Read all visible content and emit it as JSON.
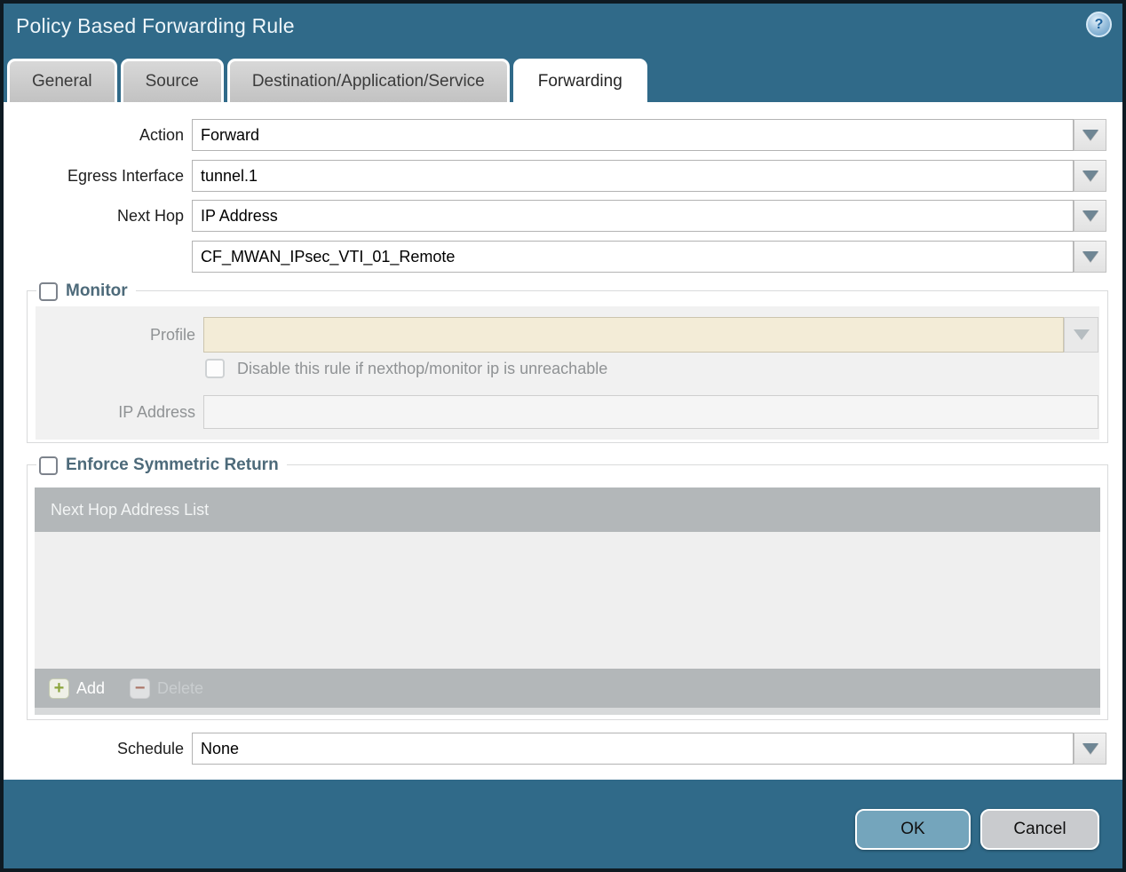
{
  "window": {
    "title": "Policy Based Forwarding Rule"
  },
  "icons": {
    "help_glyph": "?",
    "add_glyph": "+",
    "delete_glyph": "−"
  },
  "tabs": [
    {
      "label": "General",
      "active": false
    },
    {
      "label": "Source",
      "active": false
    },
    {
      "label": "Destination/Application/Service",
      "active": false
    },
    {
      "label": "Forwarding",
      "active": true
    }
  ],
  "form": {
    "action": {
      "label": "Action",
      "value": "Forward"
    },
    "egress_interface": {
      "label": "Egress Interface",
      "value": "tunnel.1"
    },
    "next_hop": {
      "label": "Next Hop",
      "value": "IP Address"
    },
    "next_hop_address": {
      "value": "CF_MWAN_IPsec_VTI_01_Remote"
    },
    "schedule": {
      "label": "Schedule",
      "value": "None"
    }
  },
  "monitor": {
    "legend": "Monitor",
    "checked": false,
    "profile": {
      "label": "Profile",
      "value": "",
      "disabled": true
    },
    "disable_rule": {
      "label": "Disable this rule if nexthop/monitor ip is unreachable",
      "checked": false,
      "disabled": true
    },
    "ip_address": {
      "label": "IP Address",
      "value": "",
      "disabled": true
    }
  },
  "enforce_symmetric_return": {
    "legend": "Enforce Symmetric Return",
    "checked": false,
    "list": {
      "header": "Next Hop Address List",
      "rows": []
    },
    "add_button": "Add",
    "delete_button": "Delete",
    "delete_disabled": true
  },
  "footer": {
    "ok": "OK",
    "cancel": "Cancel"
  },
  "colors": {
    "titlebar_teal": "#306a89",
    "legend_slate": "#4d6a7a",
    "profile_field_cream": "#f3ecd7",
    "table_header_gray": "#b3b7b9",
    "add_icon_green": "#8ba53d",
    "delete_icon_red": "#ac7668",
    "ok_button_blue": "#74a5bc",
    "cancel_button_gray": "#c9cbce"
  }
}
